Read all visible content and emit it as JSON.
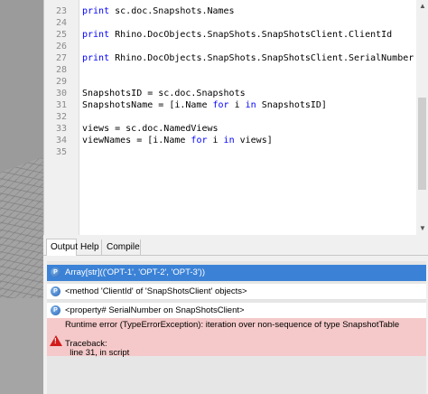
{
  "editor": {
    "lines": [
      {
        "num": "23",
        "code": [
          {
            "t": "print",
            "k": true
          },
          {
            "t": " sc.doc.Snapshots.Names",
            "k": false
          }
        ]
      },
      {
        "num": "24",
        "code": []
      },
      {
        "num": "25",
        "code": [
          {
            "t": "print",
            "k": true
          },
          {
            "t": " Rhino.DocObjects.SnapShots.SnapShotsClient.ClientId",
            "k": false
          }
        ]
      },
      {
        "num": "26",
        "code": []
      },
      {
        "num": "27",
        "code": [
          {
            "t": "print",
            "k": true
          },
          {
            "t": " Rhino.DocObjects.SnapShots.SnapShotsClient.SerialNumber",
            "k": false
          }
        ]
      },
      {
        "num": "28",
        "code": []
      },
      {
        "num": "29",
        "code": []
      },
      {
        "num": "30",
        "code": [
          {
            "t": "SnapshotsID = sc.doc.Snapshots",
            "k": false
          }
        ]
      },
      {
        "num": "31",
        "code": [
          {
            "t": "SnapshotsName = [i.Name ",
            "k": false
          },
          {
            "t": "for",
            "k": true
          },
          {
            "t": " i ",
            "k": false
          },
          {
            "t": "in",
            "k": true
          },
          {
            "t": " SnapshotsID]",
            "k": false
          }
        ]
      },
      {
        "num": "32",
        "code": []
      },
      {
        "num": "33",
        "code": [
          {
            "t": "views = sc.doc.NamedViews",
            "k": false
          }
        ]
      },
      {
        "num": "34",
        "code": [
          {
            "t": "viewNames = [i.Name ",
            "k": false
          },
          {
            "t": "for",
            "k": true
          },
          {
            "t": " i ",
            "k": false
          },
          {
            "t": "in",
            "k": true
          },
          {
            "t": " views]",
            "k": false
          }
        ]
      },
      {
        "num": "35",
        "code": []
      }
    ]
  },
  "tabs": [
    {
      "label": "Output"
    },
    {
      "label": "Help"
    },
    {
      "label": "Compile"
    }
  ],
  "output": {
    "rows": [
      {
        "text": "Array[str](('OPT-1', 'OPT-2', 'OPT-3'))",
        "icon": "python-icon"
      },
      {
        "text": "<method 'ClientId' of 'SnapShotsClient' objects>",
        "icon": "python-icon"
      },
      {
        "text": "<property# SerialNumber on SnapShotsClient>",
        "icon": "python-icon"
      }
    ],
    "error": {
      "message": "Runtime error (TypeErrorException): iteration over non-sequence of type SnapshotTable",
      "traceback_label": "Traceback:",
      "traceback_line": "  line 31, in script",
      "icon": "warning-icon"
    }
  },
  "colors": {
    "keyword": "#0000ff",
    "selected_row": "#3b82d6",
    "error_row": "#f5c9c9"
  }
}
